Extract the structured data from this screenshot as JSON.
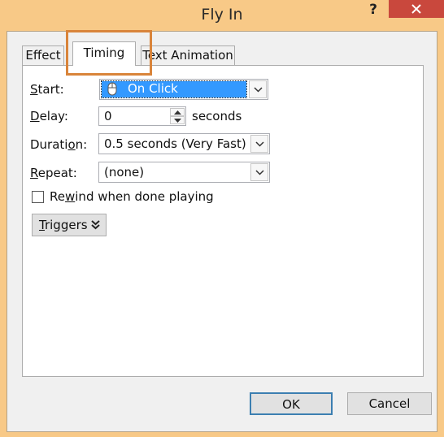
{
  "window": {
    "title": "Fly In",
    "help_label": "?"
  },
  "tabs": [
    {
      "label": "Effect"
    },
    {
      "label": "Timing"
    },
    {
      "label": "Text Animation"
    }
  ],
  "timing": {
    "start": {
      "label_key": "S",
      "label_rest": "tart:",
      "value": "On Click"
    },
    "delay": {
      "label_key": "D",
      "label_rest": "elay:",
      "value": "0",
      "unit": "seconds"
    },
    "duration": {
      "label_pre": "Durati",
      "label_key": "o",
      "label_rest": "n:",
      "value": "0.5 seconds (Very Fast)"
    },
    "repeat": {
      "label_key": "R",
      "label_rest": "epeat:",
      "value": "(none)"
    },
    "rewind": {
      "label_pre": "Re",
      "label_key": "w",
      "label_rest": "ind when done playing",
      "checked": false
    },
    "triggers": {
      "label_key": "T",
      "label_rest": "riggers"
    }
  },
  "buttons": {
    "ok": "OK",
    "cancel": "Cancel"
  },
  "colors": {
    "frame": "#f8c987",
    "close": "#c9483d",
    "selection": "#3399ff",
    "highlight": "#d9843a"
  }
}
